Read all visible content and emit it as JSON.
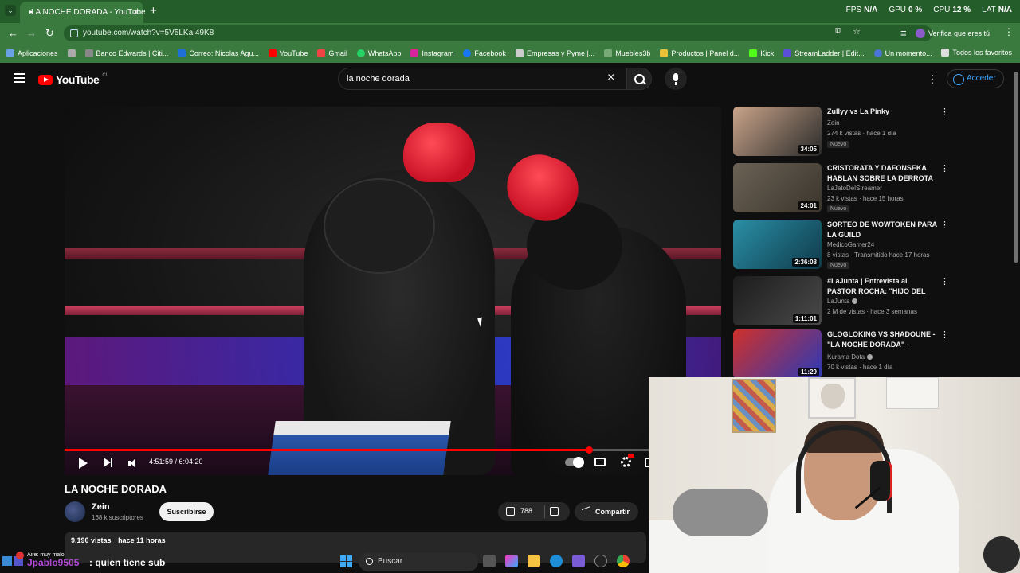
{
  "browser": {
    "tab_title": "LA NOCHE DORADA - YouTube",
    "url": "youtube.com/watch?v=5V5LKaI49K8",
    "verify_label": "Verifica que eres tú",
    "perf": [
      {
        "label": "FPS",
        "value": "N/A"
      },
      {
        "label": "GPU",
        "value": "0 %"
      },
      {
        "label": "CPU",
        "value": "12 %"
      },
      {
        "label": "LAT",
        "value": "N/A"
      }
    ],
    "bookmarks": [
      "Aplicaciones",
      "Banco Edwards | Citi...",
      "Correo: Nicolas Agu...",
      "YouTube",
      "Gmail",
      "WhatsApp",
      "Instagram",
      "Facebook",
      "Empresas y Pyme |...",
      "Muebles3b",
      "Productos | Panel d...",
      "Kick",
      "StreamLadder | Edit...",
      "Un momento..."
    ],
    "all_bookmarks": "Todos los favoritos"
  },
  "youtube": {
    "logo_text": "YouTube",
    "region": "CL",
    "search_query": "la noche dorada",
    "signin_label": "Acceder"
  },
  "player": {
    "time": "4:51:59 / 6:04:20",
    "progress": 0.799,
    "buffered": 0.62
  },
  "video": {
    "title": "LA NOCHE DORADA",
    "channel": "Zein",
    "subscribers": "168 k suscriptores",
    "subscribe_label": "Suscribirse",
    "likes": "788",
    "share_label": "Compartir",
    "views": "9,190 vistas",
    "age": "hace 11 horas"
  },
  "recommendations": [
    {
      "title": "Zullyy vs La Pinky",
      "channel": "Zein",
      "verified": false,
      "meta": "274 k vistas · hace 1 día",
      "badge": "Nuevo",
      "duration": "34:05",
      "thumb_a": "#c9a48a",
      "thumb_b": "#2a2a2a"
    },
    {
      "title": "CRISTORATA Y DAFONSEKA HABLAN SOBRE LA DERROTA ...",
      "channel": "LaJatoDelStreamer",
      "verified": false,
      "meta": "23 k vistas · hace 15 horas",
      "badge": "Nuevo",
      "duration": "24:01",
      "thumb_a": "#6b6255",
      "thumb_b": "#3a342c"
    },
    {
      "title": "SORTEO DE WOWTOKEN PARA LA GUILD",
      "channel": "MedicoGamer24",
      "verified": false,
      "meta": "8 vistas · Transmitido hace 17 horas",
      "badge": "Nuevo",
      "duration": "2:36:08",
      "thumb_a": "#2a8fa6",
      "thumb_b": "#0f3a4a"
    },
    {
      "title": "#LaJunta | Entrevista al PASTOR ROCHA: \"HIJO DEL J...",
      "channel": "LaJunta",
      "verified": true,
      "meta": "2 M de vistas · hace 3 semanas",
      "badge": "",
      "duration": "1:11:01",
      "thumb_a": "#1c1c1c",
      "thumb_b": "#4a4a4a"
    },
    {
      "title": "GLOGLOKING VS SHADOUNE - \"LA NOCHE DORADA\" - ELZEEI...",
      "channel": "Kurama Dota",
      "verified": true,
      "meta": "70 k vistas · hace 1 día",
      "badge": "",
      "duration": "11:29",
      "thumb_a": "#d0302a",
      "thumb_b": "#2a3ab8"
    }
  ],
  "chat": {
    "status": "Aire: muy malo",
    "user": "Jpablo9505",
    "message": ": quien tiene sub"
  },
  "taskbar": {
    "search_label": "Buscar"
  },
  "colors": {
    "accent": "#ff0000",
    "link": "#3ea6ff",
    "chrome_green": "#3b7a3f"
  }
}
